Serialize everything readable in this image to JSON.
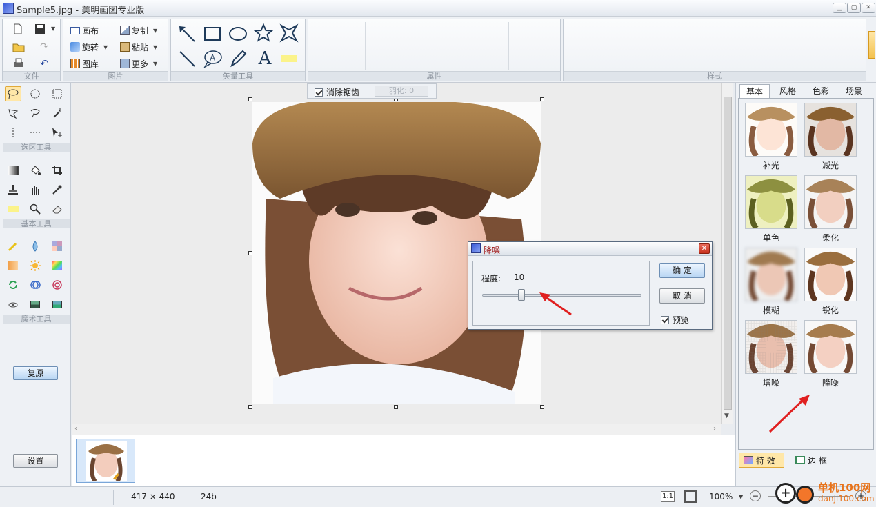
{
  "window": {
    "title": "Sample5.jpg - 美明画图专业版"
  },
  "ribbon": {
    "file": {
      "label": "文件"
    },
    "image": {
      "label": "图片",
      "canvas": "画布",
      "copy": "复制",
      "rotate": "旋转",
      "paste": "粘贴",
      "library": "图库",
      "more": "更多"
    },
    "vector": {
      "label": "矢量工具",
      "text_glyph": "A"
    },
    "props": {
      "label": "属性"
    },
    "style": {
      "label": "样式"
    }
  },
  "left": {
    "select_label": "选区工具",
    "basic_label": "基本工具",
    "magic_label": "魔术工具",
    "restore": "复原",
    "settings": "设置"
  },
  "options": {
    "antialias": "消除锯齿",
    "feather": "羽化: 0"
  },
  "dialog": {
    "title": "降噪",
    "degree_label": "程度:",
    "degree_value": "10",
    "degree_fraction": 0.1,
    "ok": "确 定",
    "cancel": "取 消",
    "preview": "预览"
  },
  "panel": {
    "tabs": [
      "基本",
      "风格",
      "色彩",
      "场景"
    ],
    "effects": [
      "补光",
      "减光",
      "单色",
      "柔化",
      "模糊",
      "锐化",
      "增噪",
      "降噪"
    ],
    "fx_button": "特 效",
    "border_button": "边 框"
  },
  "status": {
    "dims": "417 × 440",
    "depth": "24b",
    "ratio": "1:1",
    "zoom": "100%"
  },
  "watermark": {
    "brand": "单机100网",
    "url": "danji100.com"
  },
  "colors": {
    "accent": "#e0a93a",
    "arrow": "#e02020",
    "selblue": "#b7d5f3"
  }
}
